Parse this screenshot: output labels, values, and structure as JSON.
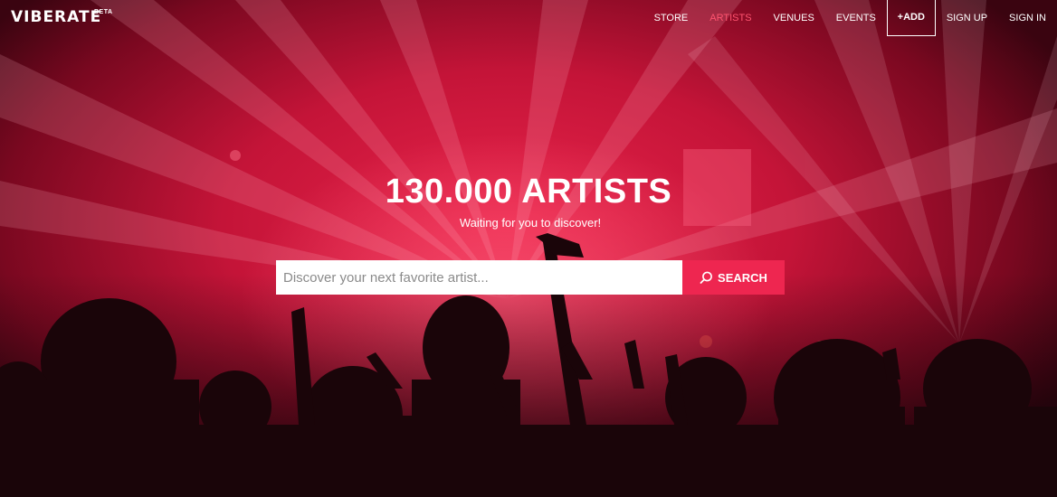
{
  "brand": {
    "name": "VIBERATE",
    "tag": "BETA"
  },
  "nav": {
    "items": [
      {
        "label": "STORE"
      },
      {
        "label": "ARTISTS",
        "active": true
      },
      {
        "label": "VENUES"
      },
      {
        "label": "EVENTS"
      },
      {
        "label": "+ADD"
      },
      {
        "label": "SIGN UP"
      },
      {
        "label": "SIGN IN"
      }
    ]
  },
  "hero": {
    "title": "130.000 ARTISTS",
    "subtitle": "Waiting for you to discover!",
    "background_image": "concert crowd silhouettes under red stage lights"
  },
  "search": {
    "placeholder": "Discover your next favorite artist...",
    "value": "",
    "button_label": "SEARCH",
    "button_icon": "search-icon"
  },
  "colors": {
    "accent": "#ee2650",
    "active_nav": "#ff5470",
    "text": "#ffffff"
  }
}
